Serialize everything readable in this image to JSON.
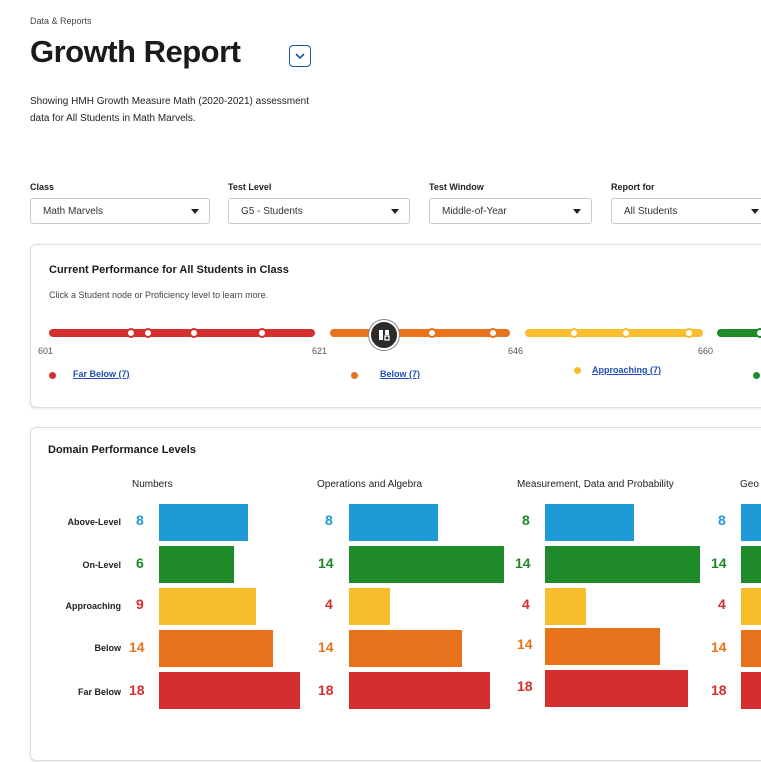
{
  "header": {
    "breadcrumb": "Data & Reports",
    "title": "Growth Report",
    "description_line1": "Showing HMH Growth Measure Math (2020-2021) assessment",
    "description_line2": "data for All Students in Math Marvels."
  },
  "filters": [
    {
      "label": "Class",
      "value": "Math Marvels"
    },
    {
      "label": "Test Level",
      "value": "G5 - Students"
    },
    {
      "label": "Test Window",
      "value": "Middle-of-Year"
    },
    {
      "label": "Report for",
      "value": "All Students"
    }
  ],
  "performance": {
    "title": "Current Performance for All Students in Class",
    "hint": "Click a Student node or Proficiency level to learn more.",
    "ticks": [
      "601",
      "621",
      "646",
      "660"
    ],
    "legend": [
      {
        "label": "Far Below (7)",
        "color": "#d32f2f"
      },
      {
        "label": "Below (7)",
        "color": "#e8731c"
      },
      {
        "label": "Approaching (7)",
        "color": "#f8bd2c"
      },
      {
        "label": "",
        "color": "#2a8a2a"
      }
    ]
  },
  "domain": {
    "title": "Domain Performance Levels",
    "row_labels": [
      "Above-Level",
      "On-Level",
      "Approaching",
      "Below",
      "Far Below"
    ],
    "colors": [
      "#1e9ad6",
      "#1e8a2a",
      "#f8bd2c",
      "#e8731c",
      "#d32f2f"
    ],
    "count_colors": [
      "#1e9ad6",
      "#1e8a2a",
      "#d32f2f",
      "#e8731c",
      "#d32f2f"
    ],
    "columns": [
      {
        "name": "Numbers",
        "counts": [
          "8",
          "6",
          "9",
          "14",
          "18"
        ]
      },
      {
        "name": "Operations and Algebra",
        "counts": [
          "8",
          "14",
          "4",
          "14",
          "18"
        ]
      },
      {
        "name": "Measurement, Data and Probability",
        "counts": [
          "8",
          "14",
          "4",
          "14",
          "18"
        ]
      },
      {
        "name": "Geo",
        "counts": [
          "8",
          "14",
          "4",
          "14",
          "18"
        ]
      }
    ]
  }
}
